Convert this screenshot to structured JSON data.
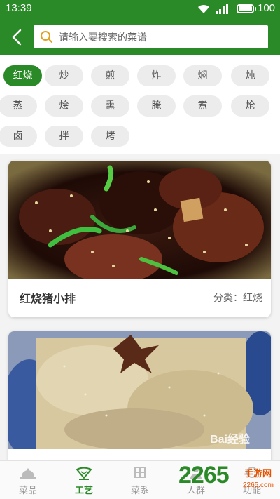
{
  "status_bar": {
    "time": "13:39",
    "battery": "100",
    "icons": [
      "wifi-icon",
      "signal-icon",
      "battery-icon"
    ]
  },
  "header": {
    "back_icon": "back-arrow-icon",
    "search_placeholder": "请输入要搜索的菜谱",
    "search_icon": "search-icon"
  },
  "categories": [
    {
      "label": "红烧",
      "active": true
    },
    {
      "label": "炒"
    },
    {
      "label": "煎"
    },
    {
      "label": "炸"
    },
    {
      "label": "焖"
    },
    {
      "label": "炖"
    },
    {
      "label": "蒸"
    },
    {
      "label": "烩"
    },
    {
      "label": "熏"
    },
    {
      "label": "腌"
    },
    {
      "label": "煮"
    },
    {
      "label": "炝"
    },
    {
      "label": "卤"
    },
    {
      "label": "拌"
    },
    {
      "label": "烤"
    }
  ],
  "recipes": [
    {
      "title": "红烧猪小排",
      "category": "分类：红烧",
      "image": "braised-pork-ribs-photo"
    },
    {
      "title": "",
      "category": "",
      "image": "braised-fish-photo",
      "watermark": "Bai经验"
    }
  ],
  "bottom_nav": [
    {
      "label": "菜品",
      "icon": "dish-cover-icon"
    },
    {
      "label": "工艺",
      "icon": "fan-icon",
      "active": true
    },
    {
      "label": "菜系",
      "icon": "grid-icon"
    },
    {
      "label": "人群",
      "icon": "people-icon"
    },
    {
      "label": "功能",
      "icon": "function-icon"
    }
  ],
  "site_watermark": {
    "brand": "2265",
    "sub": "手游网",
    "domain": "2265.com"
  },
  "colors": {
    "primary": "#2a8a27",
    "chip_bg": "#ececec",
    "background": "#f3f3f3"
  }
}
